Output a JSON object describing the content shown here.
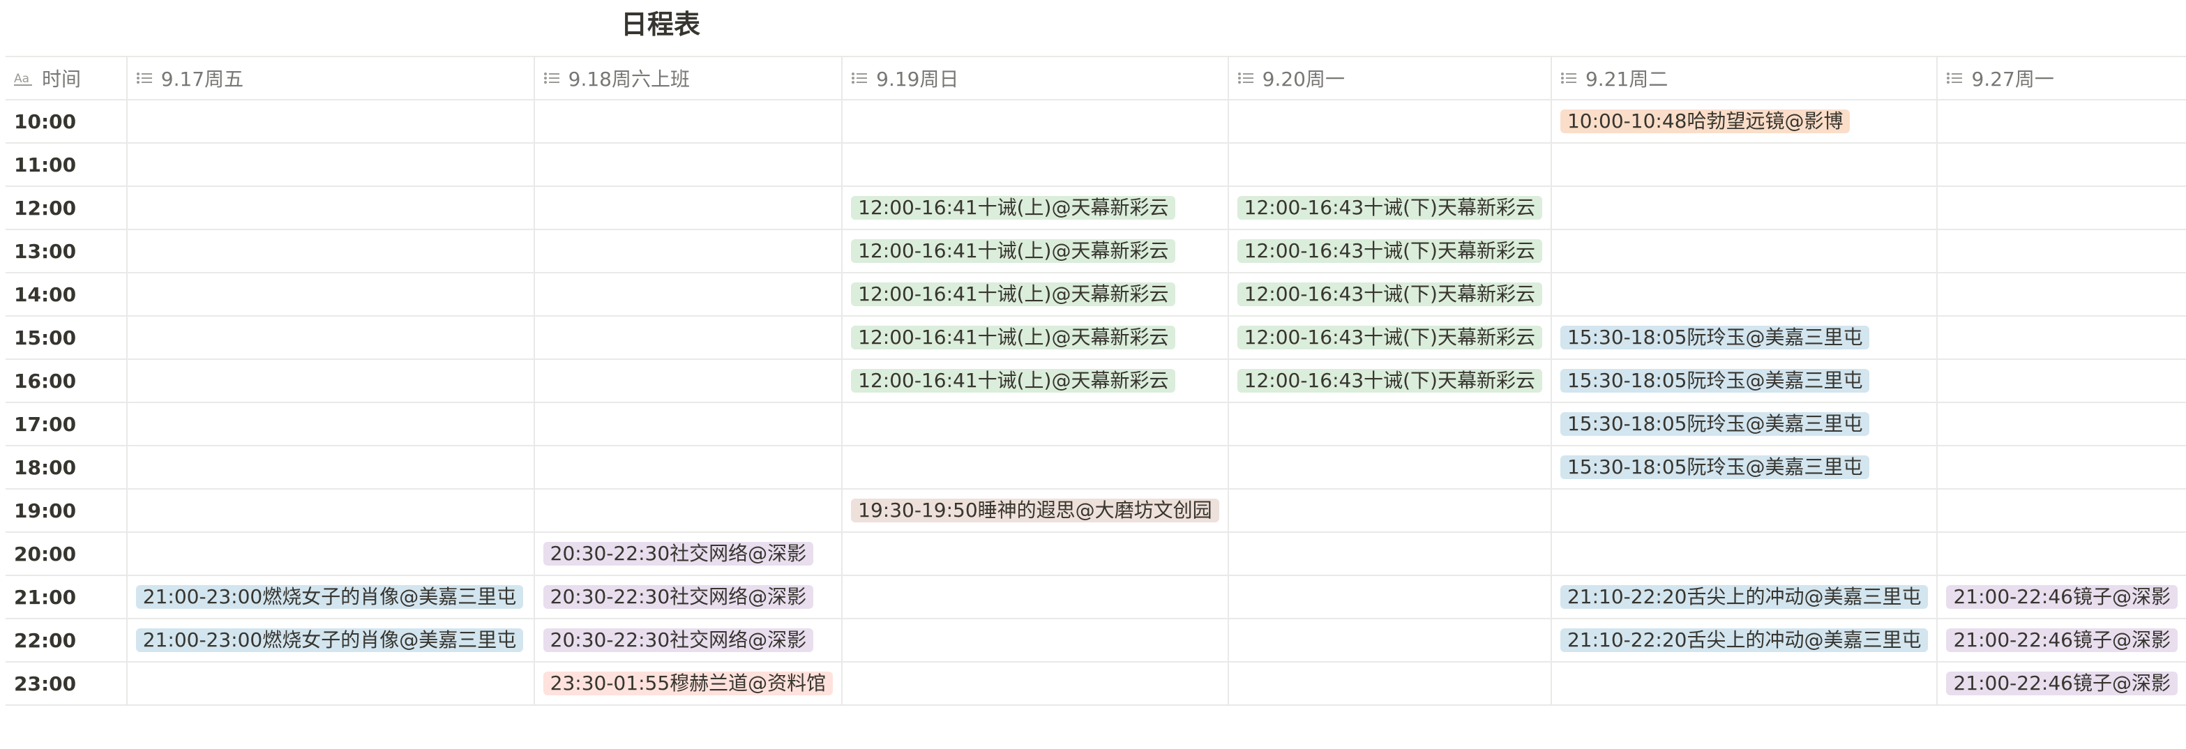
{
  "page": {
    "title": "日程表"
  },
  "header": {
    "time_icon_text": "Aa",
    "time_label": "时间",
    "days": [
      "9.17周五",
      "9.18周六上班",
      "9.19周日",
      "9.20周一",
      "9.21周二",
      "9.27周一"
    ]
  },
  "colors": {
    "orange": "#fadec9",
    "green": "#dbeddb",
    "blue": "#d3e5ef",
    "brown": "#eee0da",
    "purple": "#e8deee",
    "red": "#ffe2dd"
  },
  "rows": [
    {
      "time": "10:00",
      "cells": [
        null,
        null,
        null,
        null,
        {
          "text": "10:00-10:48哈勃望远镜@影博",
          "color": "orange"
        },
        null
      ]
    },
    {
      "time": "11:00",
      "cells": [
        null,
        null,
        null,
        null,
        null,
        null
      ]
    },
    {
      "time": "12:00",
      "cells": [
        null,
        null,
        {
          "text": "12:00-16:41十诫(上)@天幕新彩云",
          "color": "green"
        },
        {
          "text": "12:00-16:43十诫(下)天幕新彩云",
          "color": "green"
        },
        null,
        null
      ]
    },
    {
      "time": "13:00",
      "cells": [
        null,
        null,
        {
          "text": "12:00-16:41十诫(上)@天幕新彩云",
          "color": "green"
        },
        {
          "text": "12:00-16:43十诫(下)天幕新彩云",
          "color": "green"
        },
        null,
        null
      ]
    },
    {
      "time": "14:00",
      "cells": [
        null,
        null,
        {
          "text": "12:00-16:41十诫(上)@天幕新彩云",
          "color": "green"
        },
        {
          "text": "12:00-16:43十诫(下)天幕新彩云",
          "color": "green"
        },
        null,
        null
      ]
    },
    {
      "time": "15:00",
      "cells": [
        null,
        null,
        {
          "text": "12:00-16:41十诫(上)@天幕新彩云",
          "color": "green"
        },
        {
          "text": "12:00-16:43十诫(下)天幕新彩云",
          "color": "green"
        },
        {
          "text": "15:30-18:05阮玲玉@美嘉三里屯",
          "color": "blue"
        },
        null
      ]
    },
    {
      "time": "16:00",
      "cells": [
        null,
        null,
        {
          "text": "12:00-16:41十诫(上)@天幕新彩云",
          "color": "green"
        },
        {
          "text": "12:00-16:43十诫(下)天幕新彩云",
          "color": "green"
        },
        {
          "text": "15:30-18:05阮玲玉@美嘉三里屯",
          "color": "blue"
        },
        null
      ]
    },
    {
      "time": "17:00",
      "cells": [
        null,
        null,
        null,
        null,
        {
          "text": "15:30-18:05阮玲玉@美嘉三里屯",
          "color": "blue"
        },
        null
      ]
    },
    {
      "time": "18:00",
      "cells": [
        null,
        null,
        null,
        null,
        {
          "text": "15:30-18:05阮玲玉@美嘉三里屯",
          "color": "blue"
        },
        null
      ]
    },
    {
      "time": "19:00",
      "cells": [
        null,
        null,
        {
          "text": "19:30-19:50睡神的遐思@大磨坊文创园",
          "color": "brown"
        },
        null,
        null,
        null
      ]
    },
    {
      "time": "20:00",
      "cells": [
        null,
        {
          "text": "20:30-22:30社交网络@深影",
          "color": "purple"
        },
        null,
        null,
        null,
        null
      ]
    },
    {
      "time": "21:00",
      "cells": [
        {
          "text": "21:00-23:00燃烧女子的肖像@美嘉三里屯",
          "color": "blue"
        },
        {
          "text": "20:30-22:30社交网络@深影",
          "color": "purple"
        },
        null,
        null,
        {
          "text": "21:10-22:20舌尖上的冲动@美嘉三里屯",
          "color": "blue"
        },
        {
          "text": "21:00-22:46镜子@深影",
          "color": "purple"
        }
      ]
    },
    {
      "time": "22:00",
      "cells": [
        {
          "text": "21:00-23:00燃烧女子的肖像@美嘉三里屯",
          "color": "blue"
        },
        {
          "text": "20:30-22:30社交网络@深影",
          "color": "purple"
        },
        null,
        null,
        {
          "text": "21:10-22:20舌尖上的冲动@美嘉三里屯",
          "color": "blue"
        },
        {
          "text": "21:00-22:46镜子@深影",
          "color": "purple"
        }
      ]
    },
    {
      "time": "23:00",
      "cells": [
        null,
        {
          "text": "23:30-01:55穆赫兰道@资料馆",
          "color": "red"
        },
        null,
        null,
        null,
        {
          "text": "21:00-22:46镜子@深影",
          "color": "purple"
        }
      ]
    }
  ]
}
